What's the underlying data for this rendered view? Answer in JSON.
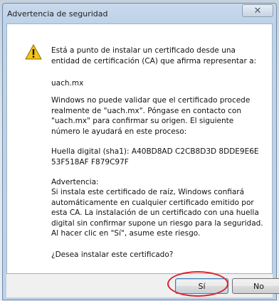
{
  "window": {
    "title": "Advertencia de seguridad",
    "close_glyph": "✕"
  },
  "message": {
    "intro": "Está a punto de instalar un certificado desde una entidad de certificación (CA) que afirma representar a:",
    "domain": "uach.mx",
    "validation": "Windows no puede validar que el certificado procede realmente de \"uach.mx\". Póngase en contacto con \"uach.mx\" para confirmar su origen. El siguiente número le ayudará en este proceso:",
    "thumbprint": "Huella digital (sha1): A40BD8AD C2CB8D3D 8DDE9E6E 53F518AF F879C97F",
    "warning_heading": "Advertencia:",
    "warning_body": "Si instala este certificado de raíz, Windows confiará automáticamente en cualquier certificado emitido por esta CA. La instalación de un certificado con una huella digital sin confirmar supone un riesgo para la seguridad. Al hacer clic en \"Sí\", asume este riesgo.",
    "question": "¿Desea instalar este certificado?"
  },
  "buttons": {
    "yes_label": "Sí",
    "no_label": "No"
  },
  "icons": {
    "warning": "warning-icon",
    "close": "close-icon"
  },
  "colors": {
    "annotation": "#d9232d",
    "warning_fill": "#f5c518"
  }
}
